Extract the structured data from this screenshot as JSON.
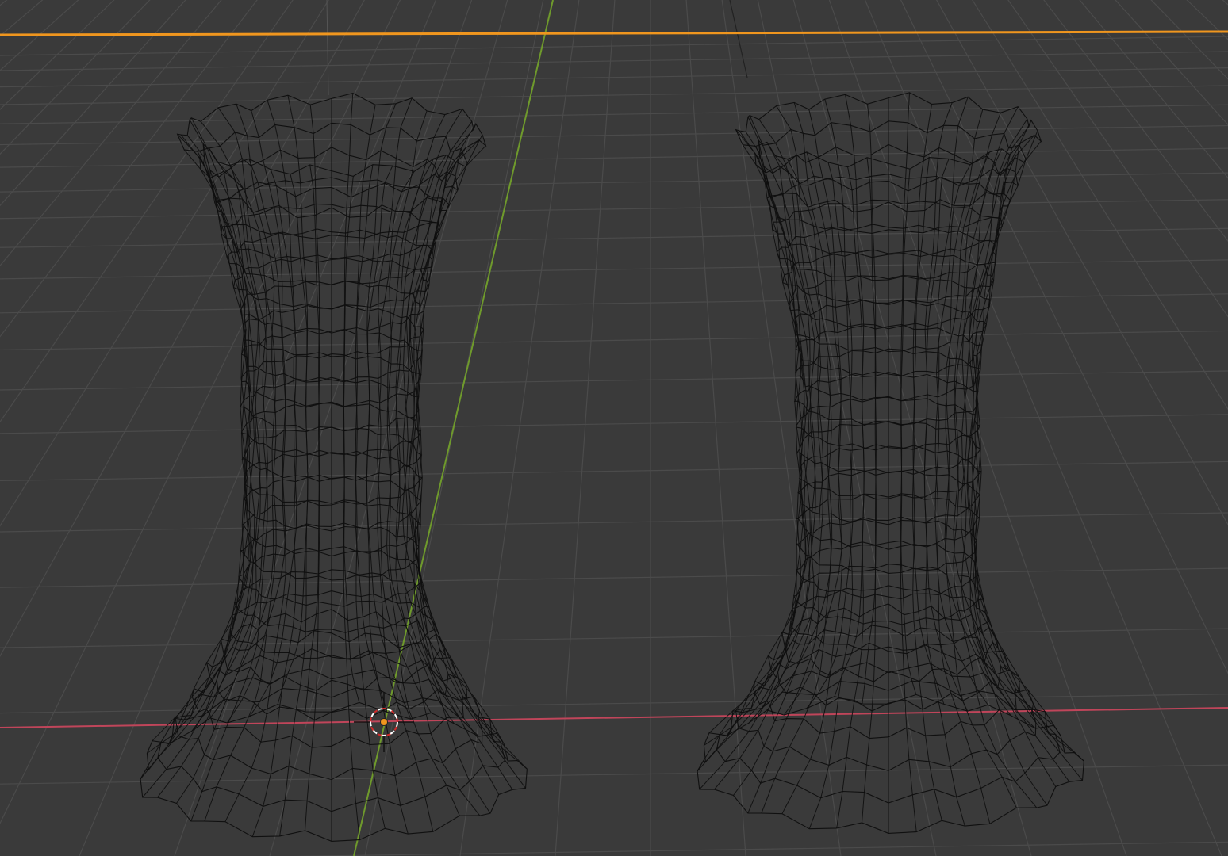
{
  "viewport": {
    "mode": "wireframe",
    "background_color": "#3a3a3a",
    "grid_color": "#4b4b4b",
    "x_axis_color": "#c0455a",
    "y_axis_color": "#6f9a2c",
    "selection_outline_color": "#f0961e",
    "wire_color": "#0e0e0e"
  },
  "scene": {
    "objects": [
      {
        "name": "vase-left"
      },
      {
        "name": "vase-right"
      }
    ],
    "cursor": {
      "name": "3d-cursor"
    },
    "origin": {
      "name": "object-origin"
    }
  }
}
